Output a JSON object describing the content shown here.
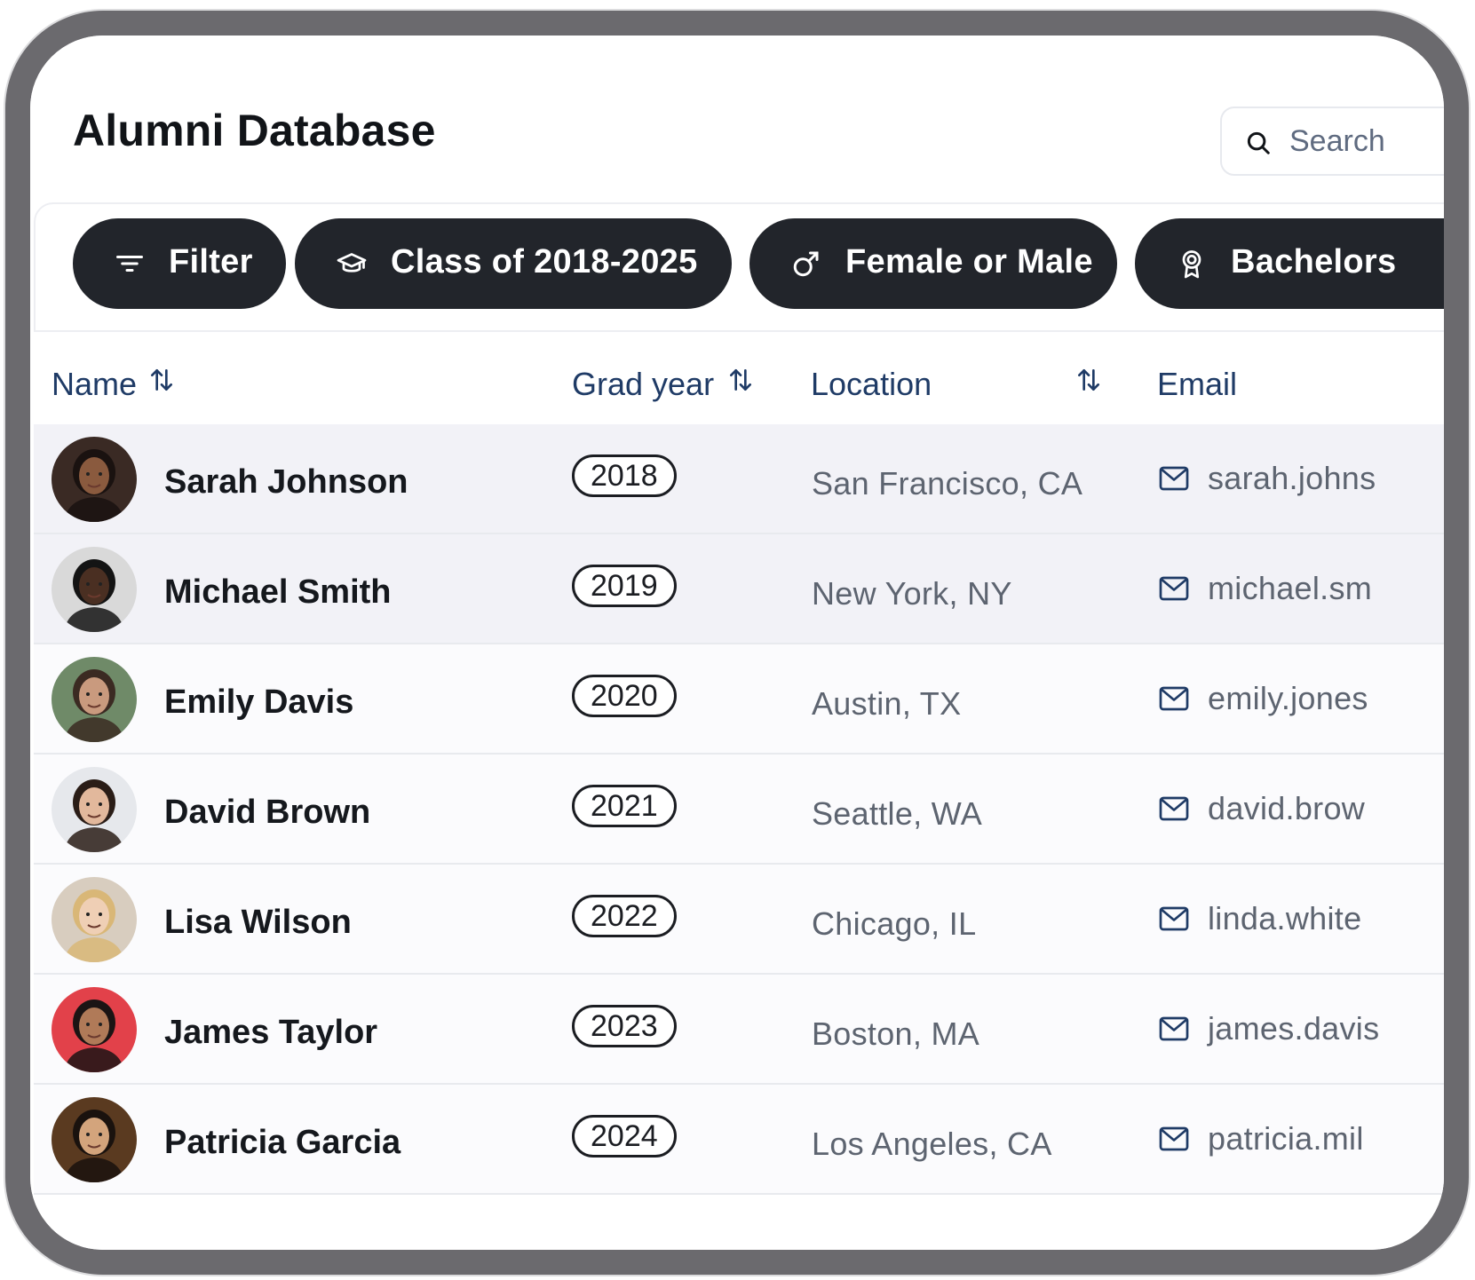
{
  "page": {
    "title": "Alumni Database"
  },
  "search": {
    "placeholder": "Search"
  },
  "filters": [
    {
      "label": "Filter",
      "icon": "filter-lines-icon"
    },
    {
      "label": "Class of 2018-2025",
      "icon": "graduation-cap-icon"
    },
    {
      "label": "Female or Male",
      "icon": "gender-male-icon"
    },
    {
      "label": "Bachelors",
      "icon": "award-ribbon-icon"
    }
  ],
  "table": {
    "columns": [
      {
        "label": "Name",
        "sortable": true
      },
      {
        "label": "Grad year",
        "sortable": true
      },
      {
        "label": "Location",
        "sortable": true
      },
      {
        "label": "Email",
        "sortable": false
      }
    ],
    "rows": [
      {
        "name": "Sarah Johnson",
        "year": "2018",
        "location": "San Francisco, CA",
        "email": "sarah.johns",
        "avatar_bg": "#3a2a24",
        "skin": "#8a5a3e",
        "hair": "#1a1210"
      },
      {
        "name": "Michael Smith",
        "year": "2019",
        "location": "New York, NY",
        "email": "michael.sm",
        "avatar_bg": "#d9d9d9",
        "skin": "#4a2f22",
        "hair": "#141414"
      },
      {
        "name": "Emily Davis",
        "year": "2020",
        "location": "Austin, TX",
        "email": "emily.jones",
        "avatar_bg": "#6f8a68",
        "skin": "#c99a7e",
        "hair": "#3b2a22"
      },
      {
        "name": "David Brown",
        "year": "2021",
        "location": "Seattle, WA",
        "email": "david.brow",
        "avatar_bg": "#e6e8ec",
        "skin": "#e2b89c",
        "hair": "#2a1d17"
      },
      {
        "name": "Lisa Wilson",
        "year": "2022",
        "location": "Chicago, IL",
        "email": "linda.white",
        "avatar_bg": "#d8cdbf",
        "skin": "#efcfb5",
        "hair": "#d9b777"
      },
      {
        "name": "James Taylor",
        "year": "2023",
        "location": "Boston, MA",
        "email": "james.davis",
        "avatar_bg": "#e2414a",
        "skin": "#b07a58",
        "hair": "#1b1414"
      },
      {
        "name": "Patricia Garcia",
        "year": "2024",
        "location": "Los Angeles, CA",
        "email": "patricia.mil",
        "avatar_bg": "#5a3a20",
        "skin": "#d3a47c",
        "hair": "#1a120e"
      }
    ]
  },
  "colors": {
    "chip_bg": "#22252b",
    "header_text": "#1f3b66",
    "row_highlight": "#f2f2f7"
  }
}
